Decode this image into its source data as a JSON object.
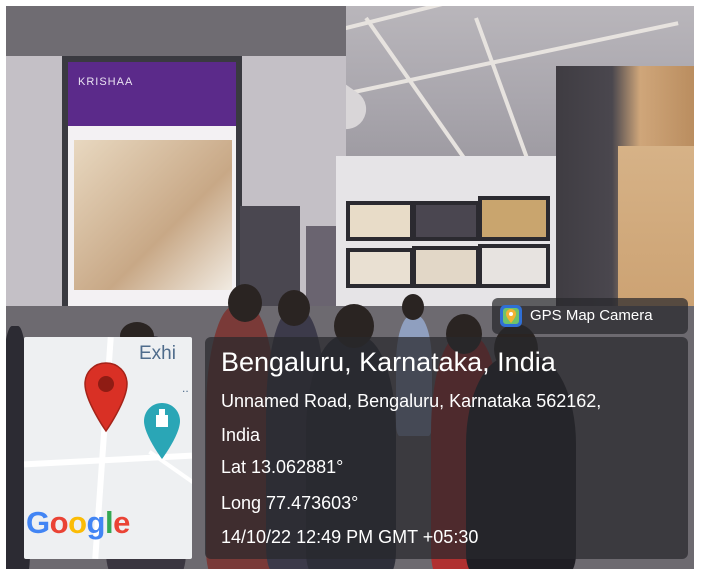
{
  "booth_sign": {
    "brand": "KRISHAA"
  },
  "badge": {
    "app_name": "GPS Map Camera",
    "icon": "gps-map-camera-icon"
  },
  "map": {
    "place_label": "Exhi",
    "ellipsis": "..",
    "logo": {
      "text": "Google",
      "letters": [
        {
          "ch": "G",
          "color": "#4285F4"
        },
        {
          "ch": "o",
          "color": "#EA4335"
        },
        {
          "ch": "o",
          "color": "#FBBC05"
        },
        {
          "ch": "g",
          "color": "#4285F4"
        },
        {
          "ch": "l",
          "color": "#34A853"
        },
        {
          "ch": "e",
          "color": "#EA4335"
        }
      ]
    },
    "pin_icon": "location-pin-icon",
    "poi_icon": "monument-pin-icon"
  },
  "location": {
    "title": "Bengaluru, Karnataka, India",
    "address_line1": "Unnamed Road, Bengaluru, Karnataka 562162,",
    "address_line2": "India",
    "latitude": "Lat 13.062881°",
    "longitude": "Long 77.473603°",
    "timestamp": "14/10/22 12:49 PM GMT +05:30"
  },
  "colors": {
    "overlay": "#28282c",
    "pin_red": "#d93025",
    "poi_teal": "#2aa6b6"
  }
}
